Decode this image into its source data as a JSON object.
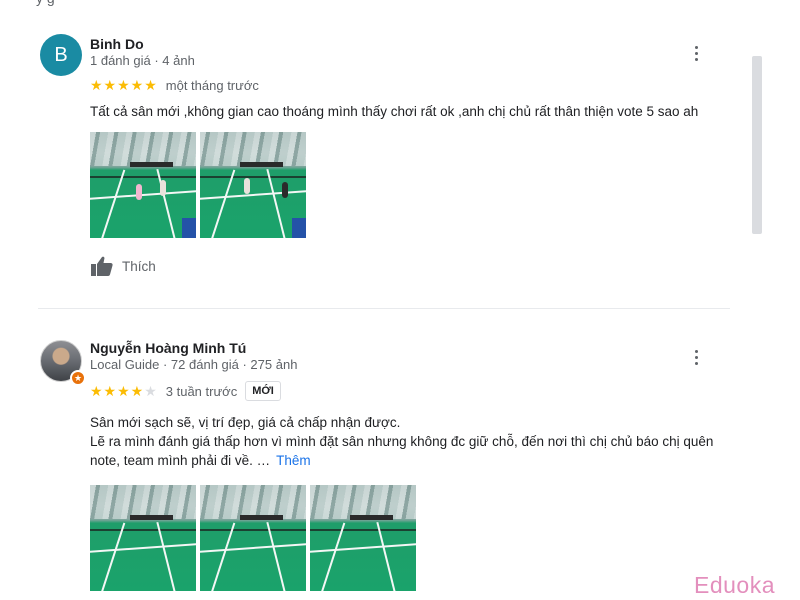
{
  "top_partial_text": "y                                           g",
  "reviews": [
    {
      "avatar_letter": "B",
      "avatar_color": "#1a8ba3",
      "name": "Binh Do",
      "meta": "1 đánh giá · 4 ảnh",
      "rating": 5,
      "stars_filled": "★★★★★",
      "stars_empty": "",
      "when": "một tháng trước",
      "badge": "",
      "text_lines": [
        "Tất cả sân mới ,không gian cao thoáng mình thấy chơi rất ok ,anh chị chủ rất thân thiện vote 5 sao ah"
      ],
      "more_link": "",
      "photo_count_visible": 2,
      "like_label": "Thích",
      "icons": {
        "more": "more-vert-icon",
        "like": "thumb-up-icon"
      }
    },
    {
      "avatar_letter": "",
      "name": "Nguyễn Hoàng Minh Tú",
      "meta": "Local Guide · 72 đánh giá · 275 ảnh",
      "rating": 4,
      "stars_filled": "★★★★",
      "stars_empty": "★",
      "when": "3 tuần trước",
      "badge": "MỚI",
      "text_lines": [
        "Sân mới sạch sẽ, vị trí đẹp, giá cả chấp nhận được.",
        "Lẽ ra mình đánh giá thấp hơn vì mình đặt sân nhưng không đc giữ chỗ, đến nơi thì chị chủ báo chị quên",
        "note, team mình phải đi về. …"
      ],
      "more_link": "Thêm",
      "photo_count_visible": 3,
      "icons": {
        "more": "more-vert-icon",
        "guide": "local-guide-badge-icon"
      }
    }
  ],
  "colors": {
    "star": "#fbbc04",
    "link": "#1a73e8",
    "watermark": "#e38fbd"
  },
  "watermark": "Eduoka"
}
